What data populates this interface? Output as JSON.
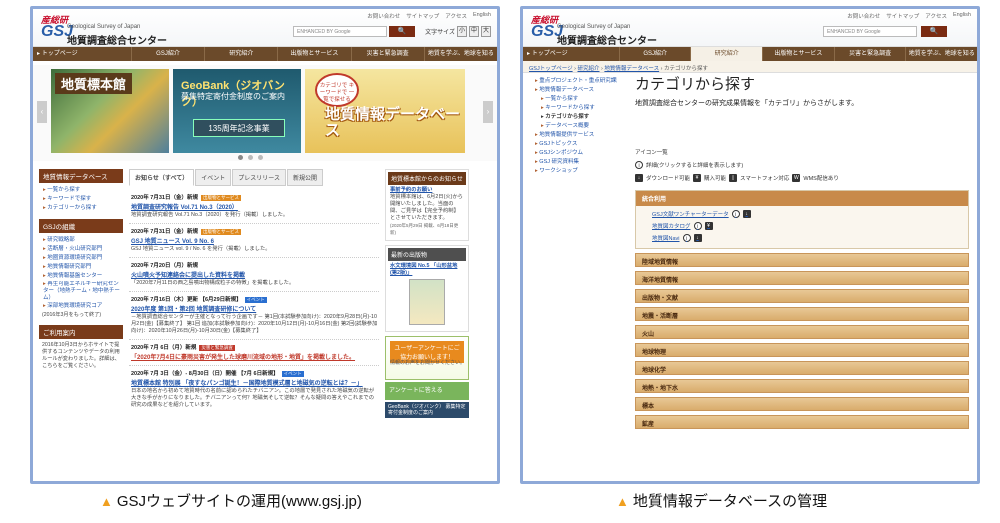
{
  "captions": {
    "left": "GSJウェブサイトの運用(www.gsj.jp)",
    "right": "地質情報データベースの管理",
    "marker": "▲"
  },
  "header": {
    "aist": "産総研",
    "gsj": "GSJ",
    "org_en": "Geological Survey of Japan",
    "org_jp": "地質調査総合センター",
    "toplinks": [
      "お問い合わせ",
      "サイトマップ",
      "アクセス",
      "English"
    ],
    "search_placeholder": "ENHANCED BY Google",
    "search_btn": "🔍",
    "fontsize_label": "文字サイズ",
    "fontsize_opts": [
      "小",
      "中",
      "大"
    ]
  },
  "nav": {
    "home": "トップページ",
    "items": [
      "GSJ紹介",
      "研究紹介",
      "出版物とサービス",
      "災害と緊急調査",
      "地質を学ぶ、地球を知る"
    ]
  },
  "left_page": {
    "banners": {
      "b1": "地質標本館",
      "b2_title": "GeoBank（ジオバンク）",
      "b2_sub": "募集特定寄付金制度のご案内",
      "b2_box": "135周年記念事業",
      "b3_tag": "カテゴリで キーワードで 一覧で探せる",
      "b3_title": "地質情報データベース"
    },
    "db_box": {
      "title": "地質情報データベース",
      "links": [
        "一覧から探す",
        "キーワードで探す",
        "カテゴリーから探す"
      ]
    },
    "org_box": {
      "title": "GSJの組織",
      "links": [
        "研究戦略部",
        "活断層・火山研究部門",
        "地圏資源環境研究部門",
        "地質情報研究部門",
        "地質情報基盤センター",
        "再生可能エネルギー研究センター（地熱チーム・地中熱チーム）",
        "深部地質環境研究コア"
      ],
      "note": "(2016年3月をもって終了)"
    },
    "notice_box": {
      "title": "ご利用案内",
      "text": "2016年10月3日からホサイトで提供するコンテンツやデータの利用ルールが変わりました。詳細は、こちらをご覧ください。"
    },
    "tabs": [
      "お知らせ（すべて）",
      "イベント",
      "プレスリリース",
      "新規公開"
    ],
    "news": [
      {
        "date": "2020年 7月31日（金）新規",
        "badge": "出版物とサービス",
        "title": "地質調査研究報告 Vol.71 No.3（2020）",
        "desc": "地質調査研究報告 Vol.71 No.3（2020）を発行（掲載）しました。"
      },
      {
        "date": "2020年 7月31日（金）新規",
        "badge": "出版物とサービス",
        "title": "GSJ 地質ニュース Vol. 9 No. 6",
        "desc": "GSJ 地質ニュース vol. 9 / No. 6 を発行（掲載）しました。"
      },
      {
        "date": "2020年 7月20日（月）新規",
        "badge": "",
        "title": "火山噴火予知連絡会に提出した資料を掲載",
        "desc": "「2020年7月11日の西之島噴出物構成粒子の特徴」を掲載しました。"
      },
      {
        "date": "2020年 7月16日（木）更新 【6月29日新規】",
        "badge": "イベント",
        "title": "2020年度 第1回・第2回 地質調査研修について",
        "desc": "－地質調査総合センターが主催となって行う企画です－ 第1回(本試験参加向け)：2020年9月28日(月)-10月2日(金)【募集終了】 第1回 追加(本試験参加向け)：2020年10月12日(月)-10月16日(金) 第2回(試験参加向け)：2020年10月26日(月)-10月30日(金)【募集終了】"
      },
      {
        "date": "2020年 7月 6日（月）新規",
        "badge": "災害と緊急調査",
        "title": "「2020年7月4日に豪雨災害が発生した球磨川流域の地形・地質」を掲載しました。",
        "desc": ""
      },
      {
        "date": "2020年 7月 3日（金）- 8月30日（日）開催 【7月 6日新規】",
        "badge": "イベント",
        "title": "地質標本館 特別展 「夜すなパンゴ誕生！－国際地質模式層と地磁気の逆転とは？－」",
        "desc": "日本の地名から初めて地質時代の名前に認められたチバニアン。この地層で発見された地磁気の逆転が大きな手がかりになりました。チバニアンって何？地磁気そして逆転？そんな疑問の答えやこれまでの研究の成果などを紹介しています。"
      }
    ],
    "side": {
      "h1": "地質標本館からのお知らせ",
      "h1_link": "事前予約のお願い",
      "h1_text": "地質標本館は、6月2日(火)から開館いたしました。当面の間、ご見学は【完全予約制】とさせていただきます。",
      "h1_date": "(2020年5月29日 掲載、6月18日更新)",
      "h2": "最新の出版物",
      "h2_link": "水文環境図 No.5 「山形盆地(第2版)」",
      "survey": "ユーザーアンケートにご協力お願いします！",
      "survey_sub": "情報のお声をお聞かせください。",
      "anq": "アンケートに答える",
      "geobank": "GeoBank（ジオバンク） 募集特定寄付金制度のご案内"
    }
  },
  "right_page": {
    "crumb": [
      "GSJトップページ",
      "研究紹介",
      "地質情報データベース",
      "カテゴリから探す"
    ],
    "side_links": [
      {
        "label": "重点プロジェクト・重点研究課題",
        "sub": false,
        "cur": false
      },
      {
        "label": "地質情報データベース",
        "sub": false,
        "cur": false
      },
      {
        "label": "一覧から探す",
        "sub": true,
        "cur": false
      },
      {
        "label": "キーワードから探す",
        "sub": true,
        "cur": false
      },
      {
        "label": "カテゴリから探す",
        "sub": true,
        "cur": true
      },
      {
        "label": "データベース概要",
        "sub": true,
        "cur": false
      },
      {
        "label": "地質情報提供サービス",
        "sub": false,
        "cur": false
      },
      {
        "label": "GSJトピックス",
        "sub": false,
        "cur": false
      },
      {
        "label": "GSJシンポジウム",
        "sub": false,
        "cur": false
      },
      {
        "label": "GSJ 研究資料集",
        "sub": false,
        "cur": false
      },
      {
        "label": "ワークショップ",
        "sub": false,
        "cur": false
      }
    ],
    "title": "カテゴリから探す",
    "intro": "地質調査総合センターの研究成果情報を「カテゴリ」からさがします。",
    "icons_head": "アイコン一覧",
    "icons_info": "詳細(クリックすると詳細を表示します)",
    "icons_row2": [
      "ダウンロード可能",
      "購入可能",
      "スマートフォン対応",
      "WMS配信あり"
    ],
    "cat_box_title": "統合利用",
    "cat_box_items": [
      "GSJ文献ワンチャーターデータ",
      "地質図カタログ",
      "地質図Navi"
    ],
    "categories": [
      "陸域地質情報",
      "海洋地質情報",
      "出版物・文献",
      "地震・活断層",
      "火山",
      "地球物理",
      "地球化学",
      "地熱・地下水",
      "標本",
      "鉱産"
    ]
  }
}
